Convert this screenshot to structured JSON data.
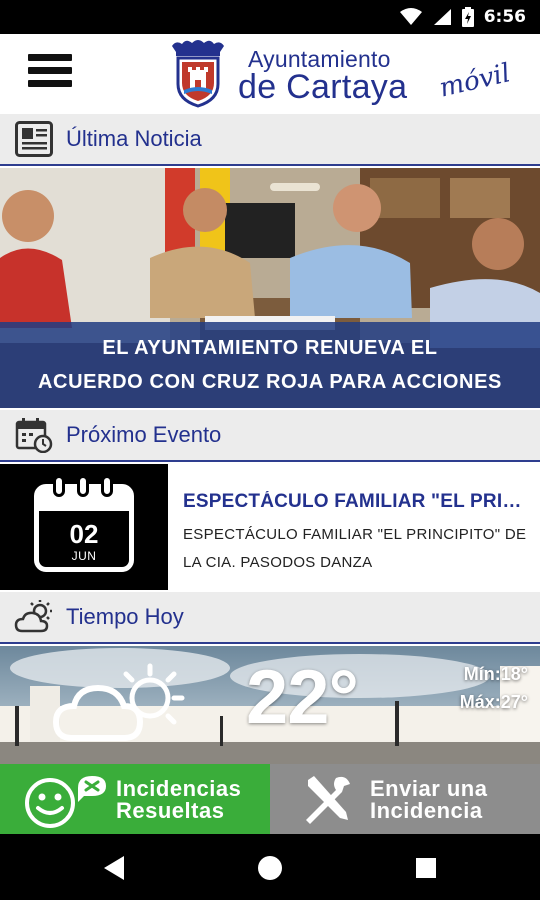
{
  "status_bar": {
    "time": "6:56",
    "icons": [
      "wifi-icon",
      "signal-icon",
      "battery-charging-icon"
    ]
  },
  "header": {
    "brand_line1": "Ayuntamiento",
    "brand_line2": "de Cartaya",
    "brand_tag": "móvil",
    "menu_icon": "hamburger-menu-icon",
    "crest_icon": "city-crest-icon"
  },
  "news": {
    "section_title": "Última Noticia",
    "icon": "newspaper-icon",
    "caption_line1": "EL AYUNTAMIENTO RENUEVA EL",
    "caption_line2": "ACUERDO CON CRUZ ROJA PARA ACCIONES"
  },
  "event": {
    "section_title": "Próximo Evento",
    "icon": "calendar-clock-icon",
    "day": "02",
    "month": "JUN",
    "title": "ESPECTÁCULO FAMILIAR \"EL PRINCIPITO\"",
    "description": "ESPECTÁCULO FAMILIAR \"EL PRINCIPITO\" DE LA CIA. PASODOS DANZA"
  },
  "weather": {
    "section_title": "Tiempo Hoy",
    "icon": "partly-cloudy-icon",
    "condition_icon": "cloud-sun-icon",
    "temperature": "22°",
    "min": "Mín:18°",
    "max": "Máx:27°"
  },
  "actions": {
    "resolved_line1": "Incidencias",
    "resolved_line2": "Resueltas",
    "report_line1": "Enviar una",
    "report_line2": "Incidencia",
    "resolved_icon": "smiley-check-icon",
    "report_icon": "tools-icon",
    "colors": {
      "resolved": "#3aad3a",
      "report": "#8d8d8d"
    }
  },
  "nav_bar": {
    "icons": [
      "back-icon",
      "home-icon",
      "recents-icon"
    ]
  },
  "colors": {
    "brand_blue": "#23318e",
    "caption_bg": "#223c82"
  }
}
